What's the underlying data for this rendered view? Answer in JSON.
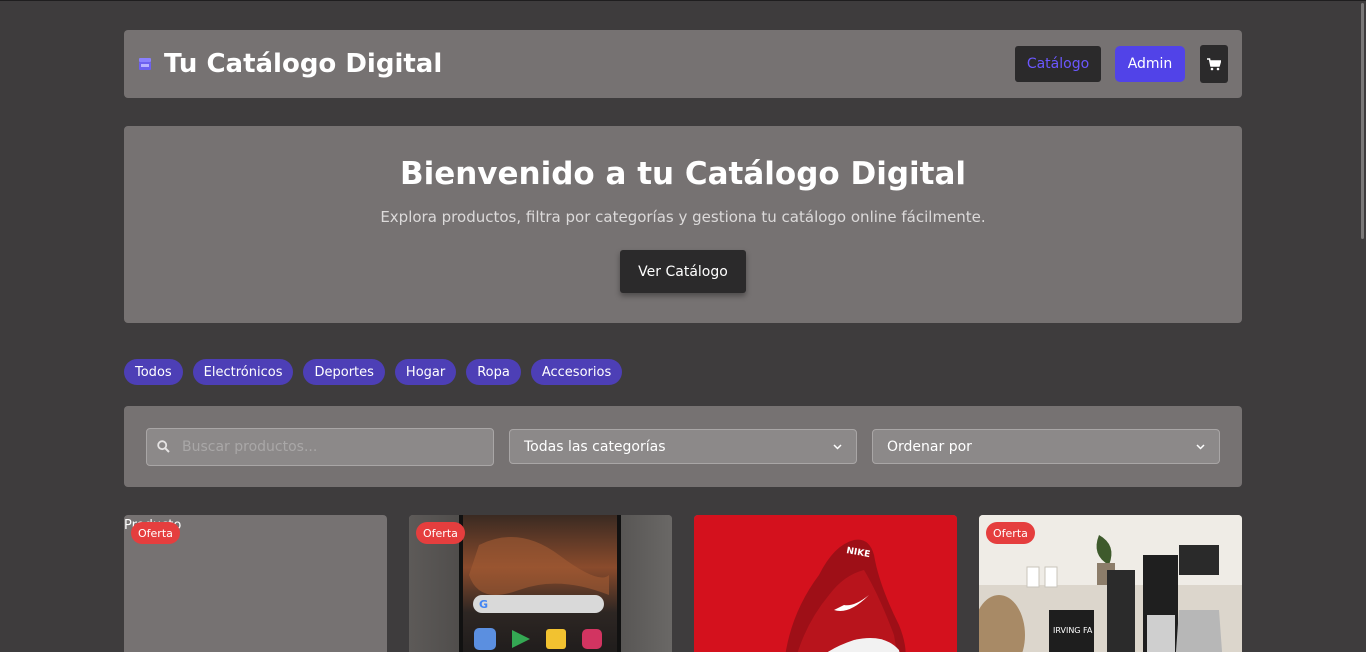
{
  "navbar": {
    "brand_icon": "store-icon",
    "title": "Tu Catálogo Digital",
    "catalog_label": "Catálogo",
    "admin_label": "Admin",
    "cart_icon": "cart-icon"
  },
  "hero": {
    "title": "Bienvenido a tu Catálogo Digital",
    "subtitle": "Explora productos, filtra por categorías y gestiona tu catálogo online fácilmente.",
    "button_label": "Ver Catálogo"
  },
  "categories": [
    "Todos",
    "Electrónicos",
    "Deportes",
    "Hogar",
    "Ropa",
    "Accesorios"
  ],
  "filters": {
    "search_placeholder": "Buscar productos...",
    "category_select": "Todas las categorías",
    "sort_select": "Ordenar por"
  },
  "products": [
    {
      "badge": "Oferta",
      "alt": "Producto",
      "image": "broken-image"
    },
    {
      "badge": "Oferta",
      "image": "smartphone-photo"
    },
    {
      "badge": "",
      "image": "red-sneaker-photo"
    },
    {
      "badge": "Oferta",
      "image": "coffee-grinder-photo"
    }
  ],
  "colors": {
    "background": "#3e3c3d",
    "panel": "#767272",
    "accent": "#5143e8",
    "pill": "#4d3fb6",
    "badge": "#e53e3e"
  }
}
